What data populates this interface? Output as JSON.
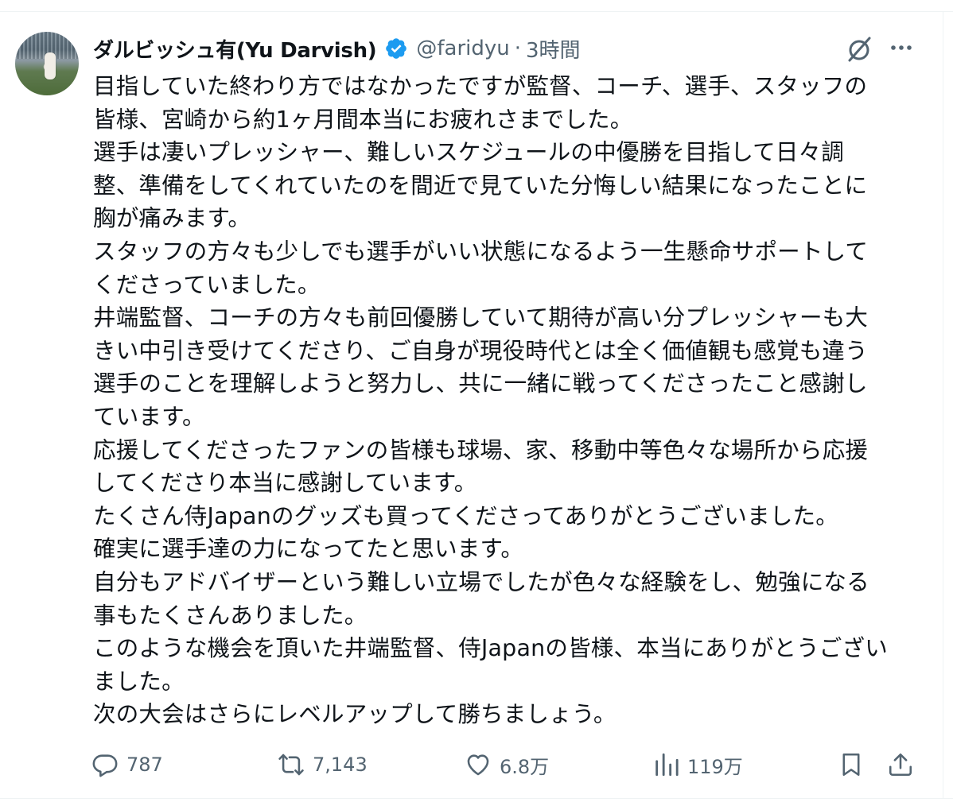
{
  "author": {
    "display_name": "ダルビッシュ有(Yu Darvish)",
    "handle": "@faridyu",
    "separator": "·",
    "time": "3時間"
  },
  "colors": {
    "verified": "#1d9bf0",
    "text": "#0f1419",
    "muted": "#536471"
  },
  "tweet_lines": [
    "目指していた終わり方ではなかったですが監督、コーチ、選手、スタッフの",
    "皆様、宮崎から約1ヶ月間本当にお疲れさまでした。",
    "選手は凄いプレッシャー、難しいスケジュールの中優勝を目指して日々調",
    "整、準備をしてくれていたのを間近で見ていた分悔しい結果になったことに",
    "胸が痛みます。",
    "スタッフの方々も少しでも選手がいい状態になるよう一生懸命サポートして",
    "くださっていました。",
    "井端監督、コーチの方々も前回優勝していて期待が高い分プレッシャーも大",
    "きい中引き受けてくださり、ご自身が現役時代とは全く価値観も感覚も違う",
    "選手のことを理解しようと努力し、共に一緒に戦ってくださったこと感謝し",
    "ています。",
    "応援してくださったファンの皆様も球場、家、移動中等色々な場所から応援",
    "してくださり本当に感謝しています。",
    "たくさん侍Japanのグッズも買ってくださってありがとうございました。",
    "確実に選手達の力になってたと思います。",
    "自分もアドバイザーという難しい立場でしたが色々な経験をし、勉強になる",
    "事もたくさんありました。",
    "このような機会を頂いた井端監督、侍Japanの皆様、本当にありがとうござい",
    "ました。",
    "次の大会はさらにレベルアップして勝ちましょう。"
  ],
  "actions": {
    "replies": "787",
    "reposts": "7,143",
    "likes": "6.8万",
    "views": "119万"
  },
  "icons": {
    "avatar": "avatar-photo",
    "verified": "verified-badge-icon",
    "grok": "grok-icon",
    "more": "more-icon",
    "reply": "reply-icon",
    "repost": "repost-icon",
    "like": "heart-icon",
    "views": "views-icon",
    "bookmark": "bookmark-icon",
    "share": "share-icon"
  }
}
